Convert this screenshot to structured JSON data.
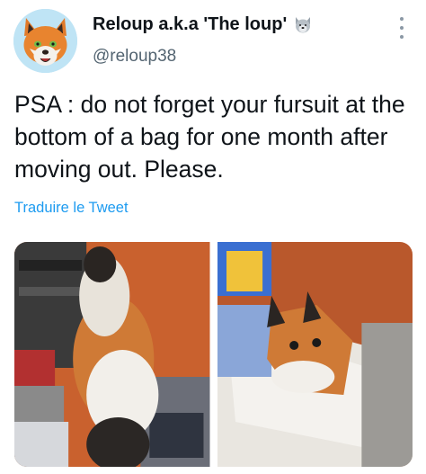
{
  "author": {
    "display_name": "Reloup a.k.a 'The loup'",
    "name_emoji": "wolf-face-icon",
    "handle": "@reloup38",
    "avatar": "fox-avatar"
  },
  "tweet": {
    "text": "PSA : do not forget your fursuit at the bottom of a bag for one month after moving out. Please.",
    "translate_label": "Traduire le Tweet"
  },
  "media": [
    {
      "name": "fursuit-on-floor-photo"
    },
    {
      "name": "fursuit-head-on-bed-photo"
    }
  ],
  "colors": {
    "link": "#1d9bf0",
    "handle": "#536471",
    "text": "#0f1419"
  }
}
